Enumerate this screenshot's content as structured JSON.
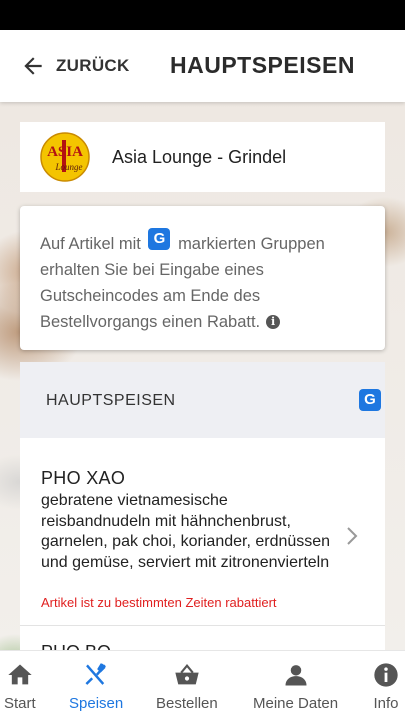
{
  "header": {
    "back_label": "ZURÜCK",
    "title": "HAUPTSPEISEN"
  },
  "restaurant": {
    "logo_text": "ASIA Lounge",
    "name": "Asia Lounge - Grindel"
  },
  "info": {
    "text_before_badge": "Auf Artikel mit",
    "badge": "G",
    "text_after_badge": "markierten Gruppen erhalten Sie bei Eingabe eines Gutscheincodes am Ende des Bestellvorgangs einen Rabatt."
  },
  "category": {
    "title": "HAUPTSPEISEN",
    "badge": "G"
  },
  "items": [
    {
      "title": "PHO XAO",
      "description": "gebratene vietnamesische reisbandnudeln mit hähnchenbrust, garnelen, pak choi, koriander, erdnüssen und gemüse, serviert mit zitronenvierteln",
      "note": "Artikel ist zu bestimmten Zeiten rabattiert"
    },
    {
      "title": "PHO BO"
    }
  ],
  "nav": [
    {
      "label": "Start",
      "icon": "home-icon"
    },
    {
      "label": "Speisen",
      "icon": "cutlery-icon"
    },
    {
      "label": "Bestellen",
      "icon": "basket-icon"
    },
    {
      "label": "Meine Daten",
      "icon": "person-icon"
    },
    {
      "label": "Info",
      "icon": "info-icon"
    }
  ],
  "colors": {
    "accent": "#1e77e0",
    "discount_note": "#e02020"
  }
}
